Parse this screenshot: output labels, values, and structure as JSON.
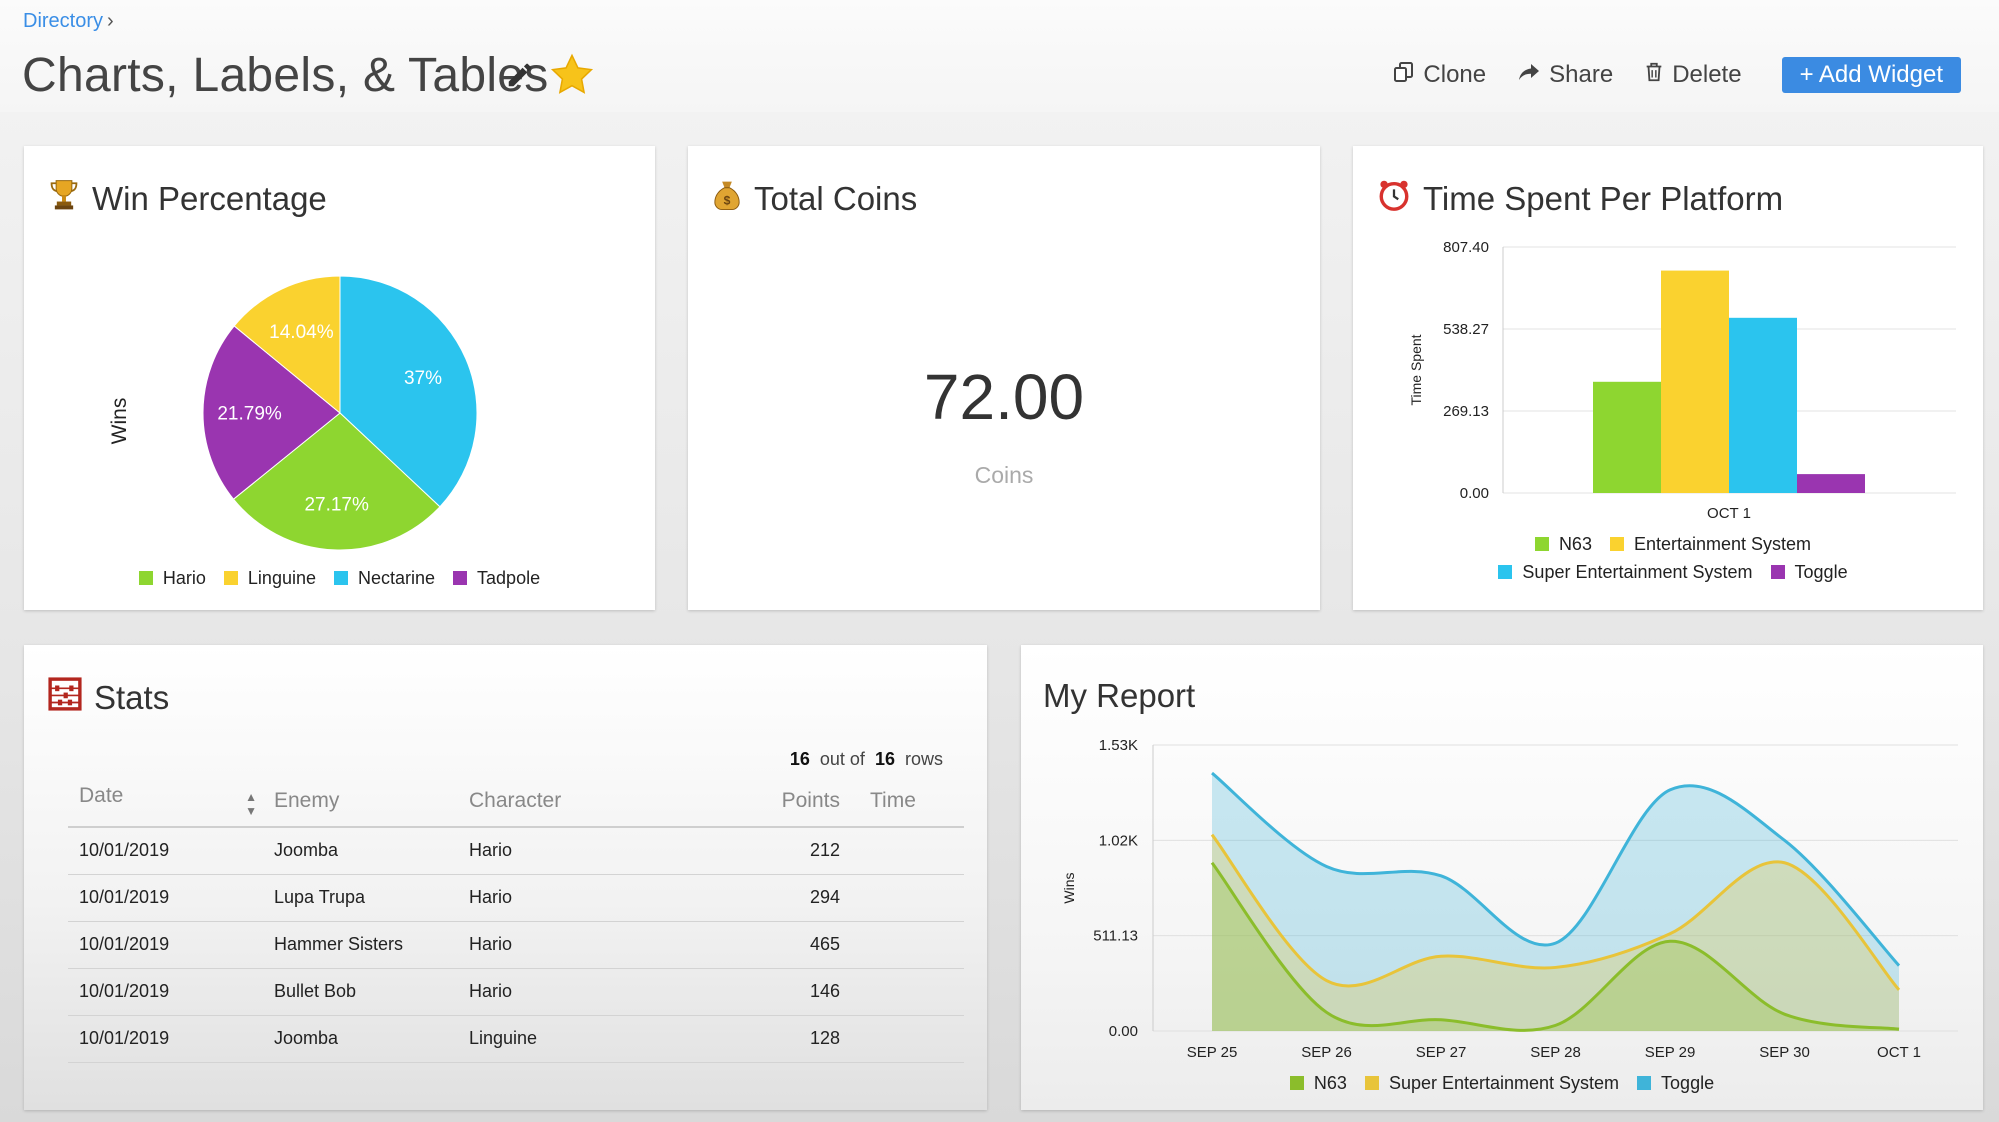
{
  "header": {
    "breadcrumb": "Directory",
    "title": "Charts, Labels, & Tables",
    "actions": {
      "clone": "Clone",
      "share": "Share",
      "delete": "Delete",
      "add_widget": "+ Add Widget"
    }
  },
  "colors": {
    "green": "#8ed630",
    "yellow": "#fad22f",
    "blue": "#2bc4ee",
    "purple": "#9a35b0",
    "area_green": "#8bbd2b",
    "area_yellow": "#e8c43a",
    "area_blue": "#3fb4d9",
    "accent": "#3b8be2"
  },
  "win_card": {
    "title": "Win Percentage",
    "icon": "trophy-icon",
    "chart_data": {
      "type": "pie",
      "ylabel": "Wins",
      "slices": [
        {
          "name": "Nectarine",
          "value": 37,
          "label": "37%",
          "color": "#2bc4ee"
        },
        {
          "name": "Hario",
          "value": 27.17,
          "label": "27.17%",
          "color": "#8ed630"
        },
        {
          "name": "Tadpole",
          "value": 21.79,
          "label": "21.79%",
          "color": "#9a35b0"
        },
        {
          "name": "Linguine",
          "value": 14.04,
          "label": "14.04%",
          "color": "#fad22f"
        }
      ],
      "legend": [
        "Hario",
        "Linguine",
        "Nectarine",
        "Tadpole"
      ],
      "legend_colors": [
        "#8ed630",
        "#fad22f",
        "#2bc4ee",
        "#9a35b0"
      ],
      "legend_position": "bottom"
    }
  },
  "coins_card": {
    "title": "Total Coins",
    "icon": "money-bag-icon",
    "value": "72.00",
    "unit": "Coins"
  },
  "time_card": {
    "title": "Time Spent Per Platform",
    "icon": "alarm-clock-icon",
    "chart_data": {
      "type": "bar",
      "categories": [
        "OCT 1"
      ],
      "ylabel": "Time Spent",
      "ylim": [
        0,
        807.4
      ],
      "yticks": [
        "0.00",
        "269.13",
        "538.27",
        "807.40"
      ],
      "series": [
        {
          "name": "N63",
          "values": [
            365
          ],
          "color": "#8ed630"
        },
        {
          "name": "Entertainment System",
          "values": [
            730
          ],
          "color": "#fad22f"
        },
        {
          "name": "Super Entertainment System",
          "values": [
            575
          ],
          "color": "#2bc4ee"
        },
        {
          "name": "Toggle",
          "values": [
            62
          ],
          "color": "#9a35b0"
        }
      ],
      "legend_position": "bottom",
      "grid": true
    }
  },
  "stats_card": {
    "title": "Stats",
    "icon": "abacus-icon",
    "rowcount": {
      "shown": "16",
      "mid": "out of",
      "total": "16",
      "suffix": "rows"
    },
    "columns": [
      "Date",
      "Enemy",
      "Character",
      "Points",
      "Time"
    ],
    "rows": [
      [
        "10/01/2019",
        "Joomba",
        "Hario",
        "212"
      ],
      [
        "10/01/2019",
        "Lupa Trupa",
        "Hario",
        "294"
      ],
      [
        "10/01/2019",
        "Hammer Sisters",
        "Hario",
        "465"
      ],
      [
        "10/01/2019",
        "Bullet Bob",
        "Hario",
        "146"
      ],
      [
        "10/01/2019",
        "Joomba",
        "Linguine",
        "128"
      ]
    ]
  },
  "report_card": {
    "title": "My Report",
    "chart_data": {
      "type": "area",
      "ylabel": "Wins",
      "ylim": [
        0,
        1530
      ],
      "yticks": [
        "0.00",
        "511.13",
        "1.02K",
        "1.53K"
      ],
      "x": [
        "SEP 25",
        "SEP 26",
        "SEP 27",
        "SEP 28",
        "SEP 29",
        "SEP 30",
        "OCT 1"
      ],
      "series": [
        {
          "name": "N63",
          "values": [
            900,
            100,
            60,
            30,
            480,
            90,
            10
          ],
          "color": "#8bbd2b"
        },
        {
          "name": "Super Entertainment System",
          "values": [
            1050,
            270,
            400,
            340,
            520,
            900,
            220
          ],
          "color": "#e8c43a"
        },
        {
          "name": "Toggle",
          "values": [
            1380,
            880,
            830,
            470,
            1290,
            1020,
            350
          ],
          "color": "#3fb4d9"
        }
      ],
      "legend_position": "bottom",
      "grid": true
    }
  }
}
